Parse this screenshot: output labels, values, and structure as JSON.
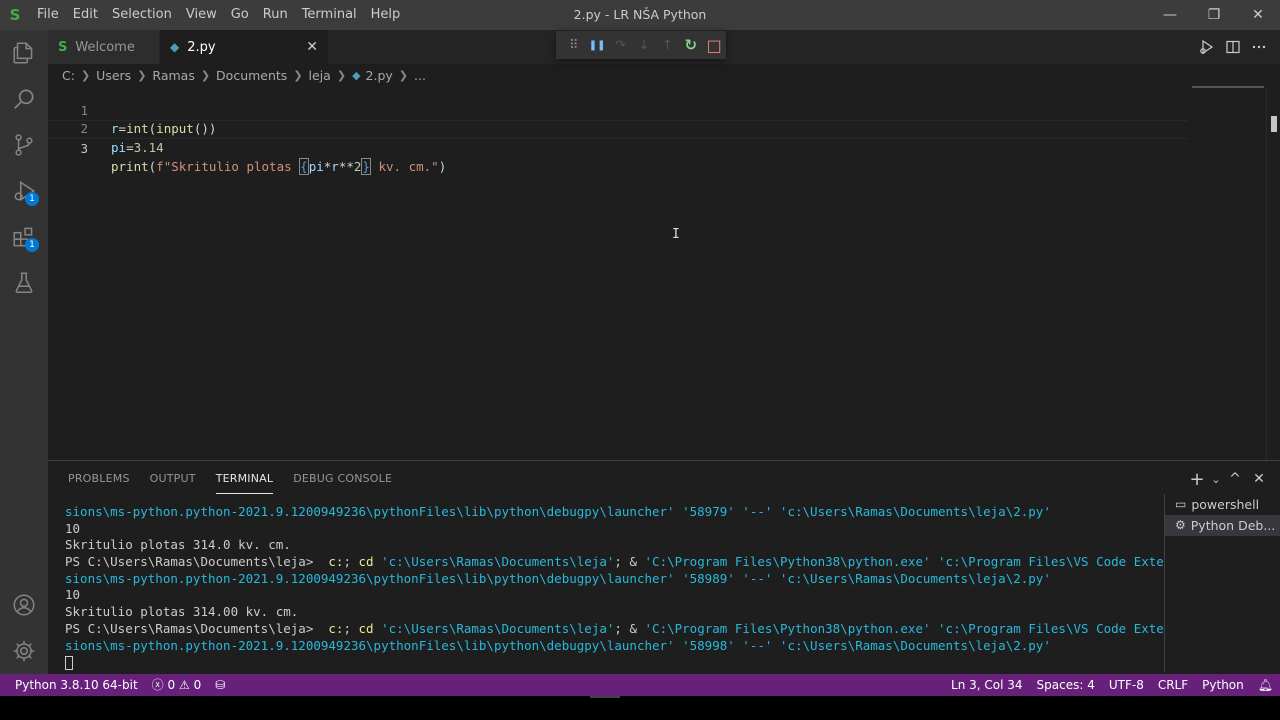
{
  "app": {
    "logo": "S",
    "window_title": "2.py - LR NŠA Python",
    "menu": [
      "File",
      "Edit",
      "Selection",
      "View",
      "Go",
      "Run",
      "Terminal",
      "Help"
    ],
    "controls": {
      "minimize": "—",
      "restore": "❐",
      "close": "✕"
    }
  },
  "activity_bar": {
    "badges": {
      "run_debug": "1",
      "extensions": "1"
    }
  },
  "tabs": [
    {
      "label": "Welcome",
      "icon": "S"
    },
    {
      "label": "2.py",
      "icon": "py",
      "close": "✕"
    }
  ],
  "debug_toolbar": {
    "grip": "⠿",
    "pause": "❚❚",
    "step_over": "↷",
    "step_into": "↓",
    "step_out": "↑",
    "restart": "↻",
    "stop": "□"
  },
  "breadcrumb": [
    "C:",
    "Users",
    "Ramas",
    "Documents",
    "leja",
    "2.py",
    "..."
  ],
  "editor": {
    "line_numbers": [
      "1",
      "2",
      "3"
    ],
    "line1": {
      "a": "r",
      "b": "=",
      "c": "int",
      "d": "(",
      "e": "input",
      "f": "())"
    },
    "line2": {
      "a": "pi",
      "b": "=",
      "c": "3.14"
    },
    "line3": {
      "a": "print",
      "b": "(",
      "c": "f\"Skritulio plotas ",
      "d": "{",
      "e": "pi",
      "f": "*",
      "g": "r",
      "h": "**",
      "i": "2",
      "j": "}",
      "k": " kv. cm.\"",
      "l": ")"
    },
    "mouse_cursor": "I"
  },
  "panel": {
    "tabs": [
      "PROBLEMS",
      "OUTPUT",
      "TERMINAL",
      "DEBUG CONSOLE"
    ],
    "active_tab": "TERMINAL",
    "actions": {
      "add": "+",
      "dropdown": "⌄",
      "maximize": "^",
      "close": "✕"
    },
    "terminal": {
      "l1": "sions\\ms-python.python-2021.9.1200949236\\pythonFiles\\lib\\python\\debugpy\\launcher' '58979' '--' 'c:\\Users\\Ramas\\Documents\\leja\\2.py'",
      "l2": "10",
      "l3": "Skritulio plotas 314.0 kv. cm.",
      "l4_prompt": "PS C:\\Users\\Ramas\\Documents\\leja> ",
      "l4_cmd1": " c:",
      "l4_semi": "; ",
      "l4_cmd2": "cd",
      "l4_path": " 'c:\\Users\\Ramas\\Documents\\leja'",
      "l4_amp": "; & ",
      "l4_exe": "'C:\\Program Files\\Python38\\python.exe'",
      "l4_ext": " 'c:\\Program Files\\VS Code Exten",
      "l5": "sions\\ms-python.python-2021.9.1200949236\\pythonFiles\\lib\\python\\debugpy\\launcher' '58989' '--' 'c:\\Users\\Ramas\\Documents\\leja\\2.py'",
      "l6": "10",
      "l7": "Skritulio plotas 314.00 kv. cm.",
      "l8_prompt": "PS C:\\Users\\Ramas\\Documents\\leja> ",
      "l8_cmd1": " c:",
      "l8_semi": "; ",
      "l8_cmd2": "cd",
      "l8_path": " 'c:\\Users\\Ramas\\Documents\\leja'",
      "l8_amp": "; & ",
      "l8_exe": "'C:\\Program Files\\Python38\\python.exe'",
      "l8_ext": " 'c:\\Program Files\\VS Code Exten",
      "l9": "sions\\ms-python.python-2021.9.1200949236\\pythonFiles\\lib\\python\\debugpy\\launcher' '58998' '--' 'c:\\Users\\Ramas\\Documents\\leja\\2.py'"
    },
    "terminal_list": [
      {
        "label": "powershell",
        "icon": "terminal-icon"
      },
      {
        "label": "Python Deb...",
        "icon": "gear-icon"
      }
    ]
  },
  "statusbar": {
    "interpreter": "Python 3.8.10 64-bit",
    "errors": "0",
    "warnings": "0",
    "position": "Ln 3, Col 34",
    "spaces": "Spaces: 4",
    "encoding": "UTF-8",
    "eol": "CRLF",
    "language": "Python"
  },
  "colors": {
    "statusbar": "#68217a",
    "titlebar": "#3c3c3c",
    "activitybar": "#333333",
    "badge": "#0078d4"
  }
}
